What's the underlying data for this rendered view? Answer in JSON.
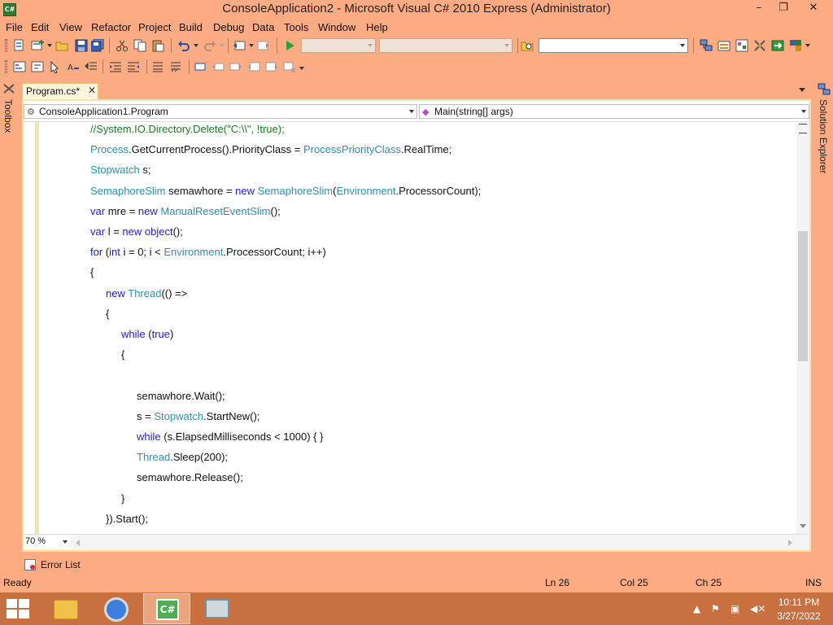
{
  "window": {
    "title": "ConsoleApplication2 - Microsoft Visual C# 2010 Express (Administrator)",
    "app_icon_text": "C#",
    "minimize_glyph": "–",
    "maximize_glyph": "❐",
    "close_glyph": "✕"
  },
  "menu": [
    "File",
    "Edit",
    "View",
    "Refactor",
    "Project",
    "Build",
    "Debug",
    "Data",
    "Tools",
    "Window",
    "Help"
  ],
  "panels": {
    "toolbox_label": "Toolbox",
    "solution_explorer_label": "Solution Explorer"
  },
  "document_tab": {
    "label": "Program.cs*",
    "close_glyph": "✕"
  },
  "navigation": {
    "type_selector": "ConsoleApplication1.Program",
    "member_selector": "Main(string[] args)"
  },
  "code_lines": [
    "//System.IO.Directory.Delete(\"C:\\\\\", !true);",
    "Process.GetCurrentProcess().PriorityClass = ProcessPriorityClass.RealTime;",
    "Stopwatch s;",
    "SemaphoreSlim semawhore = new SemaphoreSlim(Environment.ProcessorCount);",
    "var mre = new ManualResetEventSlim();",
    "var l = new object();",
    "for (int i = 0; i < Environment.ProcessorCount; i++)",
    "{",
    "new Thread(() =>",
    "{",
    "while (true)",
    "{",
    "",
    "semawhore.Wait();",
    "s = Stopwatch.StartNew();",
    "while (s.ElapsedMilliseconds < 1000) { }",
    "Thread.Sleep(200);",
    "semawhore.Release();",
    "}",
    "}).Start();"
  ],
  "syntax_colors": {
    "keyword": "#1d1dc7",
    "type": "#2b91af",
    "comment": "#1d7d1d"
  },
  "editor": {
    "zoom": "70 %"
  },
  "error_list": {
    "label": "Error List"
  },
  "status_bar": {
    "ready": "Ready",
    "line": "Ln 26",
    "column": "Col 25",
    "char": "Ch 25",
    "insert_mode": "INS"
  },
  "taskbar": {
    "apps": [
      "file-explorer",
      "chrome",
      "visual-csharp-express",
      "task-manager"
    ],
    "active_app": "visual-csharp-express",
    "time": "10:11 PM",
    "date": "3/27/2022"
  },
  "theme": {
    "chrome_background": "#fdab82",
    "taskbar_background": "#c8703f",
    "editor_background": "#ffffff"
  }
}
